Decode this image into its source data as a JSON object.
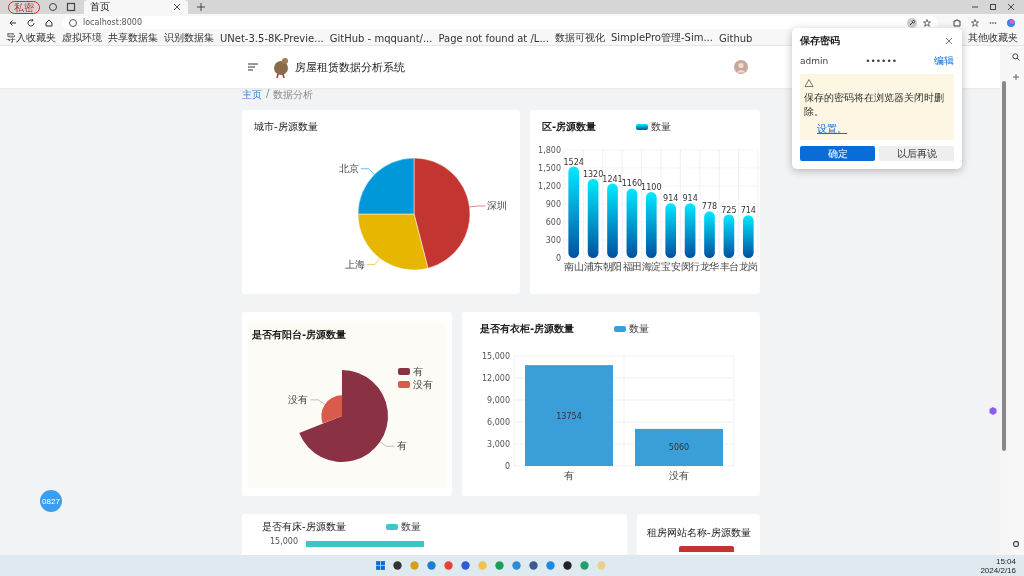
{
  "browser": {
    "profile": "私密",
    "tab_title": "首页",
    "address": "localhost:8000",
    "bookmarks": [
      "导入收藏夹",
      "虚拟环境",
      "共享数据集",
      "识别数据集",
      "UNet-3.5-8K-Previe...",
      "GitHub - mqquant/...",
      "Page not found at /L...",
      "数据可视化",
      "SimplePro管理-Sim...",
      "Github"
    ],
    "other_bookmarks": "其他收藏夹"
  },
  "password_popup": {
    "title": "保存密码",
    "username": "admin",
    "password": "••••••",
    "edit": "编辑",
    "warning": "保存的密码将在浏览器关闭时删除。",
    "warning_link": "设置。",
    "buttons": [
      "确定",
      "以后再说"
    ]
  },
  "app": {
    "title": "房屋租赁数据分析系统",
    "breadcrumb": [
      "主页",
      "数据分析"
    ],
    "breadcrumb_separator": "/"
  },
  "cards": [
    {
      "kind": "pie",
      "title": "城市-房源数量",
      "chart_data": {
        "type": "pie",
        "categories": [
          "深圳",
          "上海",
          "北京"
        ],
        "values": [
          46,
          29,
          25
        ]
      }
    },
    {
      "kind": "gradient_bar",
      "title": "区-房源数量",
      "chart_data": {
        "type": "bar",
        "categories": [
          "南山",
          "浦东",
          "朝阳",
          "福田",
          "海淀",
          "宝安",
          "闵行",
          "龙华",
          "丰台",
          "龙岗"
        ],
        "series": [
          {
            "name": "数量",
            "color": "#0a8fd8",
            "values": [
              1524,
              1320,
              1241,
              1160,
              1100,
              914,
              914,
              778,
              725,
              714
            ]
          }
        ],
        "ylim": [
          0,
          1800
        ],
        "yticks": [
          0,
          300,
          600,
          900,
          {
            "value": 1200,
            "label": "1,200"
          },
          {
            "value": 1500,
            "label": "1,500"
          },
          {
            "value": 1800,
            "label": "1,800"
          }
        ],
        "data_labels": true
      }
    },
    {
      "kind": "rose",
      "title": "是否有阳台-房源数量",
      "labels": [
        "有",
        "没有"
      ],
      "legend": [
        "有",
        "没有"
      ]
    },
    {
      "kind": "bar",
      "title": "是否有衣柜-房源数量",
      "chart_data": {
        "type": "bar",
        "categories": [
          "有",
          "没有"
        ],
        "series": [
          {
            "name": "数量",
            "color": "#3a9fd8",
            "values": [
              13754,
              5060
            ]
          }
        ],
        "grid": true,
        "ylim": [
          0,
          15000
        ],
        "yticks": [
          0,
          {
            "value": 3000,
            "label": "3,000"
          },
          {
            "value": 6000,
            "label": "6,000"
          },
          {
            "value": 9000,
            "label": "9,000"
          },
          {
            "value": 12000,
            "label": "12,000"
          },
          {
            "value": 15000,
            "label": "15,000"
          }
        ],
        "data_labels": true
      }
    },
    {
      "kind": "partial_bar",
      "title": "是否有床-房源数量",
      "legend": "数量",
      "color": "#3cc6c6",
      "tick": "15,000"
    },
    {
      "kind": "partial_pie",
      "title": "租房网站名称-房源数量",
      "color": "#c23531"
    }
  ],
  "floating_badge": "0827",
  "taskbar": {
    "time": "15:04",
    "date": "2024/2/16"
  }
}
